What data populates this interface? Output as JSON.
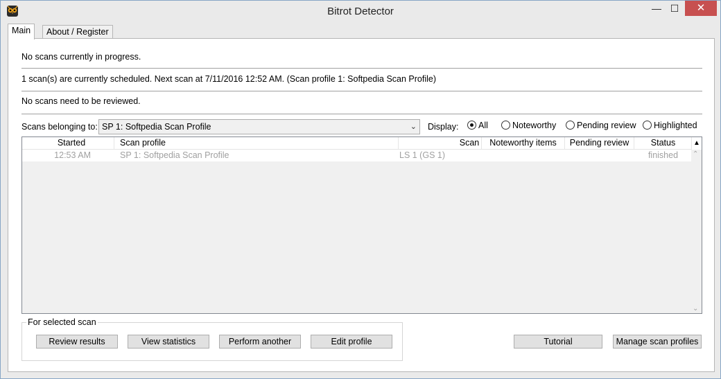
{
  "window": {
    "title": "Bitrot Detector",
    "minimize_glyph": "—",
    "maximize_glyph": "☐",
    "close_glyph": "✕"
  },
  "tabs": [
    {
      "label": "Main",
      "active": true
    },
    {
      "label": "About / Register",
      "active": false
    }
  ],
  "status": {
    "in_progress": "No scans currently in progress.",
    "scheduled": "1 scan(s) are currently scheduled.  Next scan at 7/11/2016 12:52 AM.  (Scan profile 1: Softpedia Scan Profile)",
    "review": "No scans need to be reviewed."
  },
  "filter": {
    "label": "Scans belonging to:",
    "selected": "SP 1: Softpedia Scan Profile",
    "display_label": "Display:",
    "options": [
      {
        "label": "All",
        "checked": true
      },
      {
        "label": "Noteworthy",
        "checked": false
      },
      {
        "label": "Pending review",
        "checked": false
      },
      {
        "label": "Highlighted",
        "checked": false
      }
    ]
  },
  "table": {
    "columns": [
      "Started",
      "Scan profile",
      "Scan",
      "Noteworthy items",
      "Pending review",
      "Status"
    ],
    "rows": [
      {
        "started": "12:53 AM",
        "profile": "SP 1: Softpedia Scan Profile",
        "scan": "LS 1 (GS 1)",
        "noteworthy": "",
        "pending": "",
        "status": "finished"
      }
    ],
    "sort_icon": "sort-icon"
  },
  "selected_scan": {
    "label": "For selected scan",
    "buttons": [
      "Review results",
      "View statistics",
      "Perform another",
      "Edit profile"
    ]
  },
  "actions": {
    "tutorial": "Tutorial",
    "manage": "Manage scan profiles"
  },
  "colors": {
    "close_button": "#c75050",
    "dimmed_row_text": "#a0a0a0"
  }
}
